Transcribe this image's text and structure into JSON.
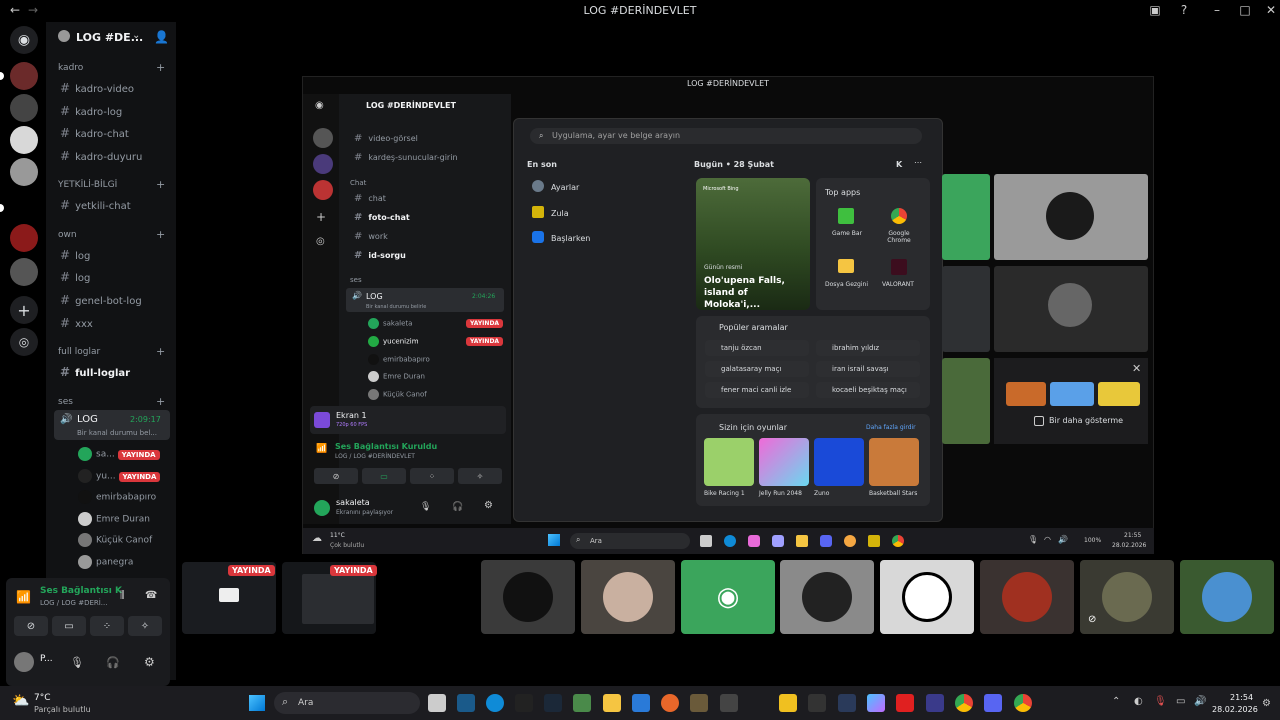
{
  "app": {
    "title": "LOG #DERİNDEVLET"
  },
  "guild": {
    "name": "LOG #DE..."
  },
  "categories": [
    {
      "label": "kadro",
      "channels": [
        "kadro-video",
        "kadro-log",
        "kadro-chat",
        "kadro-duyuru"
      ]
    },
    {
      "label": "YETKİLİ-BİLGİ",
      "channels": [
        "yetkili-chat"
      ]
    },
    {
      "label": "own",
      "channels": [
        "log",
        "log",
        "genel-bot-log",
        "xxx"
      ]
    },
    {
      "label": "full loglar",
      "channels": [
        "full-loglar"
      ]
    },
    {
      "label": "ses",
      "channels": []
    }
  ],
  "voice_channel": {
    "name": "LOG",
    "timer": "2:09:17",
    "status": "Bir kanal durumu bel..."
  },
  "voice_users": [
    {
      "name": "sa...",
      "badge": "YAYINDA"
    },
    {
      "name": "yu...",
      "badge": "YAYINDA"
    },
    {
      "name": "emirbabapıro",
      "badge": ""
    },
    {
      "name": "Emre Duran",
      "badge": ""
    },
    {
      "name": "Küçük Ꮯanof",
      "badge": ""
    },
    {
      "name": "panegra",
      "badge": ""
    }
  ],
  "voice_panel": {
    "title": "Ses Bağlantısı K",
    "subtitle": "LOG / LOG #DERİ...",
    "user": "P..."
  },
  "inner": {
    "title": "LOG #DERİNDEVLET",
    "guild_name": "LOG #DERİNDEVLET",
    "channels_top": [
      "video-görsel",
      "kardeş-sunucular-girin"
    ],
    "chat_category": "Chat",
    "chat_channels": [
      "chat",
      "foto-chat",
      "work",
      "id-sorgu"
    ],
    "ses_category": "ses",
    "voice_channel": "LOG",
    "voice_timer": "2:04:26",
    "voice_status": "Bir kanal durumu belirle",
    "voice_users": [
      {
        "name": "sakaleta",
        "badge": "YAYINDA"
      },
      {
        "name": "yucenizim",
        "badge": "YAYINDA"
      },
      {
        "name": "emirbabapıro",
        "badge": ""
      },
      {
        "name": "Emre Duran",
        "badge": ""
      },
      {
        "name": "Küçük Ꮯanof",
        "badge": ""
      }
    ],
    "screen_share": {
      "title": "Ekran 1",
      "sub": "720p 60 FPS"
    },
    "connection": {
      "title": "Ses Bağlantısı Kuruldu",
      "sub": "LOG / LOG #DERİNDEVLET"
    },
    "user": {
      "name": "sakaleta",
      "status": "Ekranını paylaşıyor"
    },
    "weather": {
      "temp": "11°C",
      "desc": "Çok bulutlu"
    },
    "search_label": "Ara",
    "battery": "100%",
    "time": "21:55",
    "date": "28.02.2026"
  },
  "start_menu": {
    "search_placeholder": "Uygulama, ayar ve belge arayın",
    "recent_label": "En son",
    "recent": [
      "Ayarlar",
      "Zula",
      "Başlarken"
    ],
    "today_label": "Bugün • 28 Şubat",
    "avatar_letter": "K",
    "bing_label": "Microsoft Bing",
    "image_of_day_label": "Günün resmi",
    "image_of_day_title": "Olo'upena Falls, island of Moloka'i,...",
    "top_apps_label": "Top apps",
    "top_apps": [
      "Game Bar",
      "Google Chrome",
      "Dosya Gezgini",
      "VALORANT"
    ],
    "popular_label": "Popüler aramalar",
    "popular": [
      "tanju özcan",
      "ibrahim yıldız",
      "galatasaray maçı",
      "iran israil savaşı",
      "fener maci canli izle",
      "kocaeli beşiktaş maçı"
    ],
    "games_label": "Sizin için oyunlar",
    "games_more": "Daha fazla girdir",
    "games": [
      "Bike Racing 1",
      "Jelly Run 2048",
      "Zuno",
      "Basketball Stars"
    ]
  },
  "popup": {
    "checkbox_label": "Bir daha gösterme"
  },
  "stream_badges": [
    "YAYINDA",
    "YAYINDA"
  ],
  "taskbar": {
    "weather_temp": "7°C",
    "weather_desc": "Parçalı bulutlu",
    "search_label": "Ara",
    "time": "21:54",
    "date": "28.02.2026"
  },
  "colors": {
    "live": "#da373c",
    "discord": "#5865f2",
    "connected": "#23a55a",
    "accent_green": "#3ba55c"
  }
}
